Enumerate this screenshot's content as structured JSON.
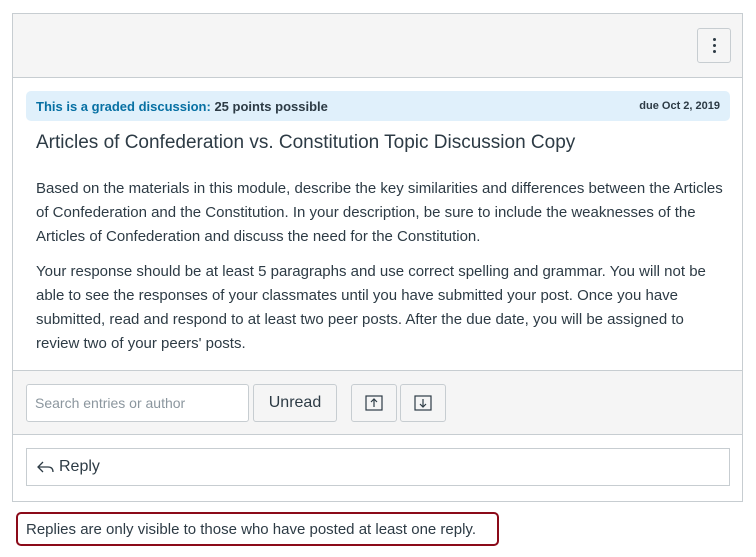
{
  "topbar": {
    "menu_icon": "kebab-menu-icon"
  },
  "graded": {
    "label": "This is a graded discussion:",
    "points": "25 points possible",
    "due": "due Oct 2, 2019",
    "label_color": "#0770a3",
    "background": "#e0f0fb"
  },
  "discussion": {
    "title": "Articles of Confederation vs. Constitution Topic Discussion Copy",
    "paragraphs": [
      "Based on the materials in this module, describe the key similarities and differences between the Articles of Confederation and the Constitution. In your description, be sure to include the weaknesses of the Articles of Confederation and discuss the need for the Constitution.",
      "Your response should be at least 5 paragraphs and use correct spelling and grammar. You will not be able to see the responses of your classmates until you have submitted your post. Once you have submitted, read and respond to at least two peer posts. After the due date, you will be assigned to review two of your peers' posts."
    ]
  },
  "toolbar": {
    "search_placeholder": "Search entries or author",
    "search_value": "",
    "unread_label": "Unread",
    "collapse_icon": "collapse-threads-icon",
    "expand_icon": "expand-threads-icon"
  },
  "reply": {
    "label": "Reply",
    "icon": "reply-arrow-icon"
  },
  "notice": {
    "text": "Replies are only visible to those who have posted at least one reply.",
    "border_color": "#8b0a19"
  }
}
